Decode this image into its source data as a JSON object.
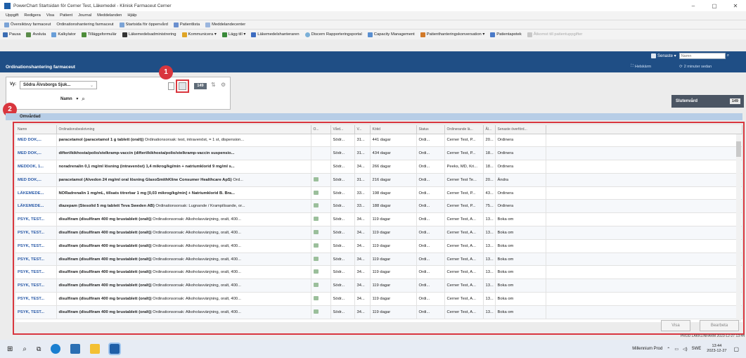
{
  "window": {
    "title": "PowerChart Startsidan för Cerner Test, Läkemedel - Klinisk Farmaceut Cerner",
    "controls": [
      "–",
      "▢",
      "✕"
    ]
  },
  "menu": [
    "Uppgift",
    "Redigera",
    "Visa",
    "Patient",
    "Journal",
    "Meddelanden",
    "Hjälp"
  ],
  "nav_bar": [
    "Översiktsvy farmaceut",
    "Ordinationshantering farmaceut",
    "Startsida för öppenvård",
    "Patientlista",
    "Meddelandecenter"
  ],
  "toolbar": [
    "Pausa",
    "Avsluta",
    "Kalkylator",
    "Tilläggsformulär",
    "Läkemedelsadministrering",
    "Kommunicera ▾",
    "Lägg till ▾",
    "Läkemedelshanteraren",
    "Discern Rapporteringsportal",
    "Capacity Management",
    "Patienthanteringskonversation ▾",
    "Patientapotek",
    "Åtkomst till patientuppgifter"
  ],
  "search": {
    "recent_label": "Senaste ▾",
    "placeholder": "Namn"
  },
  "panel": {
    "title": "Ordinationshantering farmaceut",
    "fullscreen": "Helskärm",
    "refresh": "2 minuter sedan"
  },
  "filters": {
    "view_label": "Vy:",
    "view_value": "Södra Älvsborgs Sjuk...",
    "count_badge": "149",
    "name_dropdown": "Namn",
    "search_icon": "search-icon"
  },
  "annotations": {
    "marker_1": "1",
    "marker_2": "2"
  },
  "group": {
    "label": "Slutenvård",
    "count": "149"
  },
  "section_header": "Omvårdad",
  "table": {
    "columns": [
      "Namn",
      "Ordinationsbeskrivning",
      "O...",
      "Vård...",
      "V...",
      "Kötid",
      "Status",
      "Ordinerande lä...",
      "Ål...",
      "Senaste överförd..."
    ],
    "rows": [
      [
        "MED DOK,...",
        "paracetamol (paracetamol 1 g tablett (oralt))",
        " Ordinationsorsak: test, intravenöst, = 1 st, dispension...",
        "",
        "Södr...",
        "31...",
        "441 dagar",
        "Ordi...",
        "Cerner Test, P...",
        "20...",
        "Ordinera"
      ],
      [
        "MED DOK,...",
        "difteri/kikhosta/polio/stelkramp-vaccin (difteri/kikhosta/polio/stelkramp-vaccin suspensio...",
        "",
        "",
        "Södr...",
        "31...",
        "434 dagar",
        "Ordi...",
        "Cerner Test, P...",
        "18...",
        "Ordinera"
      ],
      [
        "MEDDOK, 1...",
        "noradrenalin 0,1 mg/ml lösning (intravenöst) 1,4 mikrog/kg/min + natriumklorid 9 mg/ml s...",
        "",
        "",
        "Södr...",
        "34...",
        "266 dagar",
        "Ordi...",
        "Peeks, MD, Kri...",
        "18...",
        "Ordinera"
      ],
      [
        "MED DOK,...",
        "paracetamol (Alvedon 24 mg/ml oral lösning GlaxoSmithKline Consumer Healthcare ApS)",
        " Ord...",
        "icon",
        "Södr...",
        "31...",
        "216 dagar",
        "Ordi...",
        "Cerner Test Te...",
        "20...",
        "Ändra"
      ],
      [
        "LÄKEMEDE...",
        "NORadrenalin 1 mg/mL, tillsats titrerbar 1 mg [0,03 mikrog/kg/min] + Natriumklorid B. Bra...",
        "",
        "icon",
        "Södr...",
        "33...",
        "198 dagar",
        "Ordi...",
        "Cerner Test, P...",
        "43...",
        "Ordinera"
      ],
      [
        "LÄKEMEDE...",
        "diazepam (Stesolid 5 mg tablett Teva Sweden AB)",
        " Ordinationsorsak: Lugnande / Krampilisande, or...",
        "icon",
        "Södr...",
        "33...",
        "188 dagar",
        "Ordi...",
        "Cerner Test, P...",
        "75...",
        "Ordinera"
      ],
      [
        "PSYK, TEST...",
        "disulfiram (disulfiram 400 mg brustablett (oralt))",
        " Ordinationsorsak: Alkoholavvänjning, oralt, 400...",
        "icon",
        "Södr...",
        "34...",
        "119 dagar",
        "Ordi...",
        "Cerner Test, A...",
        "13...",
        "Boka om"
      ],
      [
        "PSYK, TEST...",
        "disulfiram (disulfiram 400 mg brustablett (oralt))",
        " Ordinationsorsak: Alkoholavvänjning, oralt, 400...",
        "icon",
        "Södr...",
        "34...",
        "119 dagar",
        "Ordi...",
        "Cerner Test, A...",
        "13...",
        "Boka om"
      ],
      [
        "PSYK, TEST...",
        "disulfiram (disulfiram 400 mg brustablett (oralt))",
        " Ordinationsorsak: Alkoholavvänjning, oralt, 400...",
        "icon",
        "Södr...",
        "34...",
        "119 dagar",
        "Ordi...",
        "Cerner Test, A...",
        "13...",
        "Boka om"
      ],
      [
        "PSYK, TEST...",
        "disulfiram (disulfiram 400 mg brustablett (oralt))",
        " Ordinationsorsak: Alkoholavvänjning, oralt, 400...",
        "icon",
        "Södr...",
        "34...",
        "119 dagar",
        "Ordi...",
        "Cerner Test, A...",
        "13...",
        "Boka om"
      ],
      [
        "PSYK, TEST...",
        "disulfiram (disulfiram 400 mg brustablett (oralt))",
        " Ordinationsorsak: Alkoholavvänjning, oralt, 400...",
        "icon",
        "Södr...",
        "34...",
        "119 dagar",
        "Ordi...",
        "Cerner Test, A...",
        "13...",
        "Boka om"
      ],
      [
        "PSYK, TEST...",
        "disulfiram (disulfiram 400 mg brustablett (oralt))",
        " Ordinationsorsak: Alkoholavvänjning, oralt, 400...",
        "icon",
        "Södr...",
        "34...",
        "119 dagar",
        "Ordi...",
        "Cerner Test, A...",
        "13...",
        "Boka om"
      ],
      [
        "PSYK, TEST...",
        "disulfiram (disulfiram 400 mg brustablett (oralt))",
        " Ordinationsorsak: Alkoholavvänjning, oralt, 400...",
        "icon",
        "Södr...",
        "34...",
        "119 dagar",
        "Ordi...",
        "Cerner Test, A...",
        "13...",
        "Boka om"
      ],
      [
        "PSYK, TEST...",
        "disulfiram (disulfiram 400 mg brustablett (oralt))",
        " Ordinationsorsak: Alkoholavvänjning, oralt, 400...",
        "icon",
        "Södr...",
        "34...",
        "119 dagar",
        "Ordi...",
        "Cerner Test, A...",
        "13...",
        "Boka om"
      ]
    ]
  },
  "buttons": {
    "visa": "Visa",
    "bearbeta": "Bearbeta"
  },
  "status_bar": "PROD  LAKKLINFARM  2023-12-27  13:44",
  "taskbar": {
    "tray_app": "Millennium Prod",
    "lang": "SWE",
    "time": "13:44",
    "date": "2023-12-27"
  },
  "colors": {
    "accent_blue": "#1f4e85",
    "marker_red": "#d9363e",
    "group_gray": "#4b5563"
  }
}
